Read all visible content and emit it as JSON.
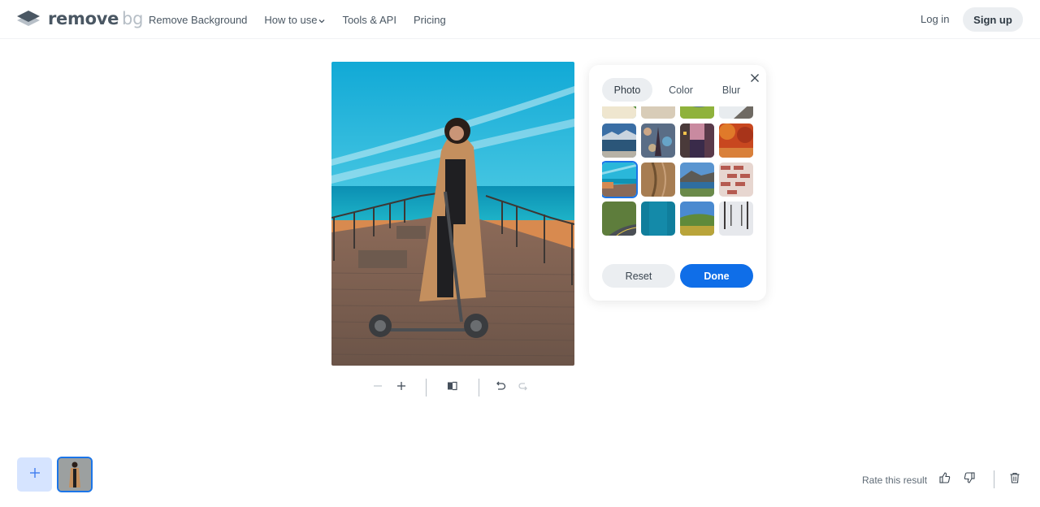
{
  "header": {
    "logo": {
      "icon": "stacked-layers-icon",
      "word_main": "remove",
      "word_accent": "bg"
    },
    "nav": [
      {
        "label": "Remove Background"
      },
      {
        "label": "How to use",
        "icon": "chevron-down-icon"
      },
      {
        "label": "Tools & API"
      },
      {
        "label": "Pricing"
      }
    ],
    "login_label": "Log in",
    "signup_label": "Sign up"
  },
  "preview": {
    "description": "Woman in camel coat with electric scooter on a wooden boardwalk by the sea, blue sky background"
  },
  "toolbar": {
    "zoom_out_icon": "minus-icon",
    "zoom_in_icon": "plus-icon",
    "compare_icon": "compare-icon",
    "undo_icon": "undo-icon",
    "redo_icon": "redo-icon"
  },
  "background_panel": {
    "tabs": [
      {
        "label": "Photo",
        "active": true
      },
      {
        "label": "Color",
        "active": false
      },
      {
        "label": "Blur",
        "active": false
      }
    ],
    "close_icon": "close-icon",
    "thumbnails": [
      {
        "name": "tropical-beach"
      },
      {
        "name": "beach-palms"
      },
      {
        "name": "hammock-grass"
      },
      {
        "name": "snowy-road"
      },
      {
        "name": "mountain-lake"
      },
      {
        "name": "eiffel-bokeh"
      },
      {
        "name": "city-street-dusk"
      },
      {
        "name": "autumn-forest"
      },
      {
        "name": "boardwalk-sea",
        "selected": true
      },
      {
        "name": "carved-wood"
      },
      {
        "name": "lake-town-mountains"
      },
      {
        "name": "brick-wall"
      },
      {
        "name": "forest-road"
      },
      {
        "name": "teal-texture"
      },
      {
        "name": "green-hills"
      },
      {
        "name": "snowy-avenue"
      }
    ],
    "reset_label": "Reset",
    "done_label": "Done",
    "accent_color": "#0f6ee8"
  },
  "footer": {
    "add_image_icon": "plus-icon",
    "rate_label": "Rate this result",
    "thumbs_up_icon": "thumbs-up-icon",
    "thumbs_down_icon": "thumbs-down-icon",
    "delete_icon": "trash-icon"
  }
}
